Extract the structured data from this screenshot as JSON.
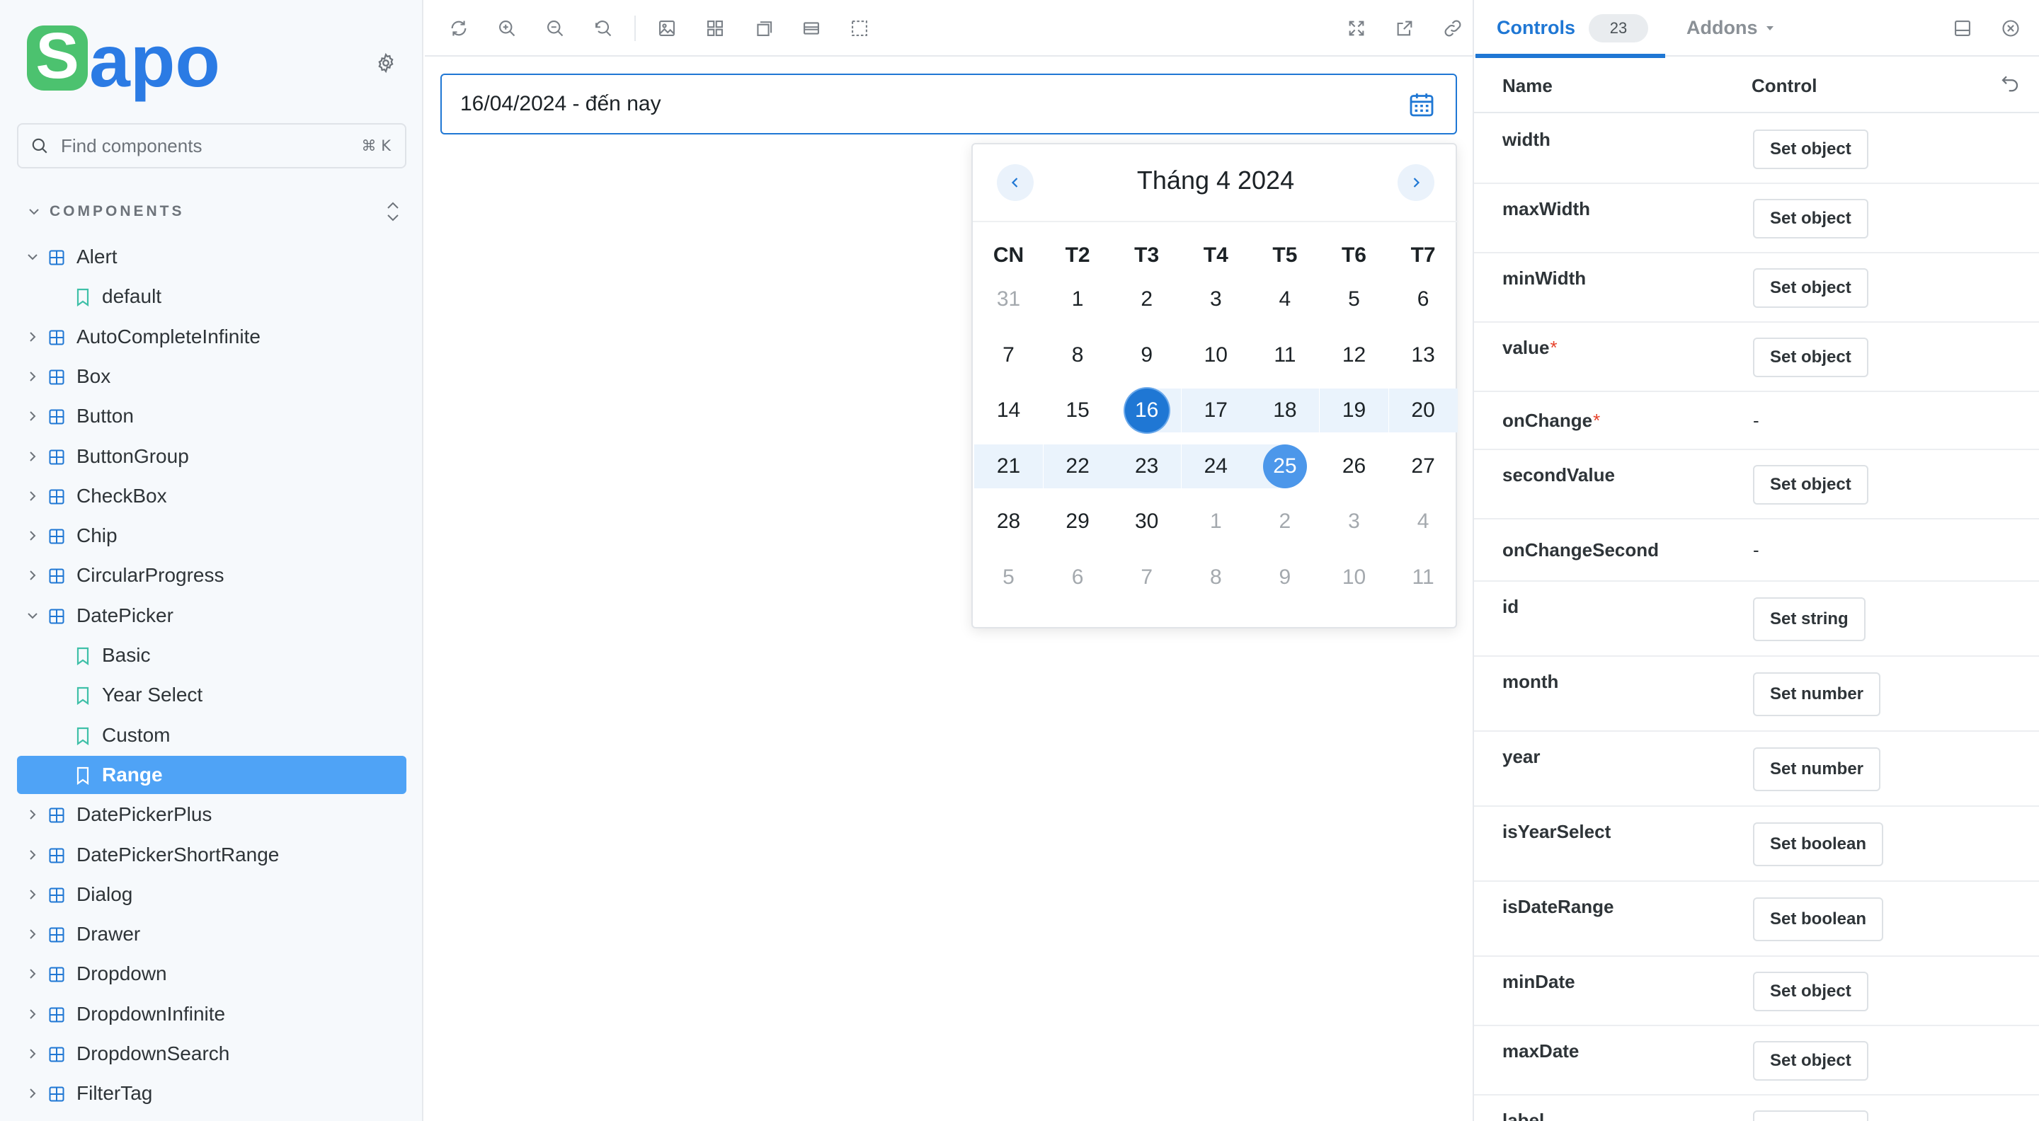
{
  "brand": {
    "logo_text": "Sapo"
  },
  "sidebar": {
    "search": {
      "placeholder": "Find components",
      "shortcut": "⌘ K"
    },
    "section_title": "COMPONENTS",
    "items": [
      {
        "label": "Alert",
        "type": "component",
        "expanded": true
      },
      {
        "label": "default",
        "type": "story"
      },
      {
        "label": "AutoCompleteInfinite",
        "type": "component",
        "expanded": false
      },
      {
        "label": "Box",
        "type": "component",
        "expanded": false
      },
      {
        "label": "Button",
        "type": "component",
        "expanded": false
      },
      {
        "label": "ButtonGroup",
        "type": "component",
        "expanded": false
      },
      {
        "label": "CheckBox",
        "type": "component",
        "expanded": false
      },
      {
        "label": "Chip",
        "type": "component",
        "expanded": false
      },
      {
        "label": "CircularProgress",
        "type": "component",
        "expanded": false
      },
      {
        "label": "DatePicker",
        "type": "component",
        "expanded": true
      },
      {
        "label": "Basic",
        "type": "story"
      },
      {
        "label": "Year Select",
        "type": "story"
      },
      {
        "label": "Custom",
        "type": "story"
      },
      {
        "label": "Range",
        "type": "story",
        "selected": true
      },
      {
        "label": "DatePickerPlus",
        "type": "component",
        "expanded": false
      },
      {
        "label": "DatePickerShortRange",
        "type": "component",
        "expanded": false
      },
      {
        "label": "Dialog",
        "type": "component",
        "expanded": false
      },
      {
        "label": "Drawer",
        "type": "component",
        "expanded": false
      },
      {
        "label": "Dropdown",
        "type": "component",
        "expanded": false
      },
      {
        "label": "DropdownInfinite",
        "type": "component",
        "expanded": false
      },
      {
        "label": "DropdownSearch",
        "type": "component",
        "expanded": false
      },
      {
        "label": "FilterTag",
        "type": "component",
        "expanded": false
      }
    ]
  },
  "toolbar": {
    "left_icons": [
      "reload-icon",
      "zoom-in-icon",
      "zoom-out-icon",
      "zoom-reset-icon",
      "background-icon",
      "grid-icon",
      "measure-icon",
      "outline-icon",
      "viewport-icon"
    ],
    "right_icons": [
      "fullscreen-icon",
      "open-new-tab-icon",
      "copy-link-icon"
    ]
  },
  "preview": {
    "date_field_value": "16/04/2024 - đến nay",
    "calendar": {
      "month_label": "Tháng 4 2024",
      "weekdays": [
        "CN",
        "T2",
        "T3",
        "T4",
        "T5",
        "T6",
        "T7"
      ],
      "weeks": [
        [
          {
            "d": "31",
            "m": true
          },
          {
            "d": "1"
          },
          {
            "d": "2"
          },
          {
            "d": "3"
          },
          {
            "d": "4"
          },
          {
            "d": "5"
          },
          {
            "d": "6"
          }
        ],
        [
          {
            "d": "7"
          },
          {
            "d": "8"
          },
          {
            "d": "9"
          },
          {
            "d": "10"
          },
          {
            "d": "11"
          },
          {
            "d": "12"
          },
          {
            "d": "13"
          }
        ],
        [
          {
            "d": "14"
          },
          {
            "d": "15"
          },
          {
            "d": "16",
            "s": "start"
          },
          {
            "d": "17",
            "r": true
          },
          {
            "d": "18",
            "r": true
          },
          {
            "d": "19",
            "r": true
          },
          {
            "d": "20",
            "r": true
          }
        ],
        [
          {
            "d": "21",
            "r": true
          },
          {
            "d": "22",
            "r": true
          },
          {
            "d": "23",
            "r": true
          },
          {
            "d": "24",
            "r": true
          },
          {
            "d": "25",
            "s": "hover"
          },
          {
            "d": "26"
          },
          {
            "d": "27"
          }
        ],
        [
          {
            "d": "28"
          },
          {
            "d": "29"
          },
          {
            "d": "30"
          },
          {
            "d": "1",
            "m": true
          },
          {
            "d": "2",
            "m": true
          },
          {
            "d": "3",
            "m": true
          },
          {
            "d": "4",
            "m": true
          }
        ],
        [
          {
            "d": "5",
            "m": true
          },
          {
            "d": "6",
            "m": true
          },
          {
            "d": "7",
            "m": true
          },
          {
            "d": "8",
            "m": true
          },
          {
            "d": "9",
            "m": true
          },
          {
            "d": "10",
            "m": true
          },
          {
            "d": "11",
            "m": true
          }
        ]
      ]
    }
  },
  "panel": {
    "tab_controls": "Controls",
    "tab_controls_count": "23",
    "tab_addons": "Addons",
    "col_name": "Name",
    "col_control": "Control",
    "rows": [
      {
        "name": "width",
        "control": "Set object",
        "required": false
      },
      {
        "name": "maxWidth",
        "control": "Set object",
        "required": false
      },
      {
        "name": "minWidth",
        "control": "Set object",
        "required": false
      },
      {
        "name": "value",
        "control": "Set object",
        "required": true
      },
      {
        "name": "onChange",
        "control": "-",
        "required": true
      },
      {
        "name": "secondValue",
        "control": "Set object",
        "required": false
      },
      {
        "name": "onChangeSecond",
        "control": "-",
        "required": false
      },
      {
        "name": "id",
        "control": "Set string",
        "required": false
      },
      {
        "name": "month",
        "control": "Set number",
        "required": false
      },
      {
        "name": "year",
        "control": "Set number",
        "required": false
      },
      {
        "name": "isYearSelect",
        "control": "Set boolean",
        "required": false
      },
      {
        "name": "isDateRange",
        "control": "Set boolean",
        "required": false
      },
      {
        "name": "minDate",
        "control": "Set object",
        "required": false
      },
      {
        "name": "maxDate",
        "control": "Set object",
        "required": false
      },
      {
        "name": "label",
        "control": "Set object",
        "required": false
      }
    ]
  },
  "colors": {
    "accent": "#1f77d4",
    "selection": "#4fa3f6",
    "logo_green": "#4cc26f",
    "logo_blue": "#2b7be4",
    "required": "#e6422b"
  }
}
